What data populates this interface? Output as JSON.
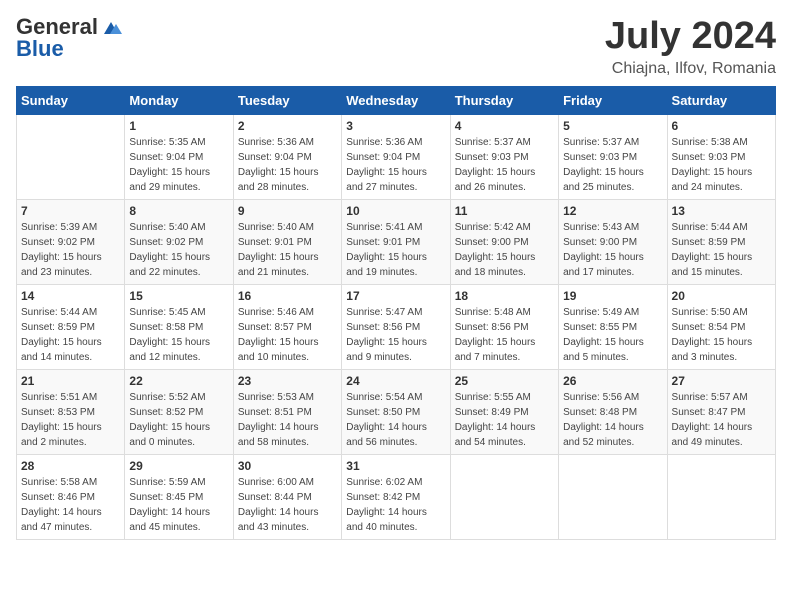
{
  "logo": {
    "general": "General",
    "blue": "Blue"
  },
  "title": "July 2024",
  "location": "Chiajna, Ilfov, Romania",
  "days_of_week": [
    "Sunday",
    "Monday",
    "Tuesday",
    "Wednesday",
    "Thursday",
    "Friday",
    "Saturday"
  ],
  "weeks": [
    [
      {
        "day": "",
        "sunrise": "",
        "sunset": "",
        "daylight": ""
      },
      {
        "day": "1",
        "sunrise": "Sunrise: 5:35 AM",
        "sunset": "Sunset: 9:04 PM",
        "daylight": "Daylight: 15 hours and 29 minutes."
      },
      {
        "day": "2",
        "sunrise": "Sunrise: 5:36 AM",
        "sunset": "Sunset: 9:04 PM",
        "daylight": "Daylight: 15 hours and 28 minutes."
      },
      {
        "day": "3",
        "sunrise": "Sunrise: 5:36 AM",
        "sunset": "Sunset: 9:04 PM",
        "daylight": "Daylight: 15 hours and 27 minutes."
      },
      {
        "day": "4",
        "sunrise": "Sunrise: 5:37 AM",
        "sunset": "Sunset: 9:03 PM",
        "daylight": "Daylight: 15 hours and 26 minutes."
      },
      {
        "day": "5",
        "sunrise": "Sunrise: 5:37 AM",
        "sunset": "Sunset: 9:03 PM",
        "daylight": "Daylight: 15 hours and 25 minutes."
      },
      {
        "day": "6",
        "sunrise": "Sunrise: 5:38 AM",
        "sunset": "Sunset: 9:03 PM",
        "daylight": "Daylight: 15 hours and 24 minutes."
      }
    ],
    [
      {
        "day": "7",
        "sunrise": "Sunrise: 5:39 AM",
        "sunset": "Sunset: 9:02 PM",
        "daylight": "Daylight: 15 hours and 23 minutes."
      },
      {
        "day": "8",
        "sunrise": "Sunrise: 5:40 AM",
        "sunset": "Sunset: 9:02 PM",
        "daylight": "Daylight: 15 hours and 22 minutes."
      },
      {
        "day": "9",
        "sunrise": "Sunrise: 5:40 AM",
        "sunset": "Sunset: 9:01 PM",
        "daylight": "Daylight: 15 hours and 21 minutes."
      },
      {
        "day": "10",
        "sunrise": "Sunrise: 5:41 AM",
        "sunset": "Sunset: 9:01 PM",
        "daylight": "Daylight: 15 hours and 19 minutes."
      },
      {
        "day": "11",
        "sunrise": "Sunrise: 5:42 AM",
        "sunset": "Sunset: 9:00 PM",
        "daylight": "Daylight: 15 hours and 18 minutes."
      },
      {
        "day": "12",
        "sunrise": "Sunrise: 5:43 AM",
        "sunset": "Sunset: 9:00 PM",
        "daylight": "Daylight: 15 hours and 17 minutes."
      },
      {
        "day": "13",
        "sunrise": "Sunrise: 5:44 AM",
        "sunset": "Sunset: 8:59 PM",
        "daylight": "Daylight: 15 hours and 15 minutes."
      }
    ],
    [
      {
        "day": "14",
        "sunrise": "Sunrise: 5:44 AM",
        "sunset": "Sunset: 8:59 PM",
        "daylight": "Daylight: 15 hours and 14 minutes."
      },
      {
        "day": "15",
        "sunrise": "Sunrise: 5:45 AM",
        "sunset": "Sunset: 8:58 PM",
        "daylight": "Daylight: 15 hours and 12 minutes."
      },
      {
        "day": "16",
        "sunrise": "Sunrise: 5:46 AM",
        "sunset": "Sunset: 8:57 PM",
        "daylight": "Daylight: 15 hours and 10 minutes."
      },
      {
        "day": "17",
        "sunrise": "Sunrise: 5:47 AM",
        "sunset": "Sunset: 8:56 PM",
        "daylight": "Daylight: 15 hours and 9 minutes."
      },
      {
        "day": "18",
        "sunrise": "Sunrise: 5:48 AM",
        "sunset": "Sunset: 8:56 PM",
        "daylight": "Daylight: 15 hours and 7 minutes."
      },
      {
        "day": "19",
        "sunrise": "Sunrise: 5:49 AM",
        "sunset": "Sunset: 8:55 PM",
        "daylight": "Daylight: 15 hours and 5 minutes."
      },
      {
        "day": "20",
        "sunrise": "Sunrise: 5:50 AM",
        "sunset": "Sunset: 8:54 PM",
        "daylight": "Daylight: 15 hours and 3 minutes."
      }
    ],
    [
      {
        "day": "21",
        "sunrise": "Sunrise: 5:51 AM",
        "sunset": "Sunset: 8:53 PM",
        "daylight": "Daylight: 15 hours and 2 minutes."
      },
      {
        "day": "22",
        "sunrise": "Sunrise: 5:52 AM",
        "sunset": "Sunset: 8:52 PM",
        "daylight": "Daylight: 15 hours and 0 minutes."
      },
      {
        "day": "23",
        "sunrise": "Sunrise: 5:53 AM",
        "sunset": "Sunset: 8:51 PM",
        "daylight": "Daylight: 14 hours and 58 minutes."
      },
      {
        "day": "24",
        "sunrise": "Sunrise: 5:54 AM",
        "sunset": "Sunset: 8:50 PM",
        "daylight": "Daylight: 14 hours and 56 minutes."
      },
      {
        "day": "25",
        "sunrise": "Sunrise: 5:55 AM",
        "sunset": "Sunset: 8:49 PM",
        "daylight": "Daylight: 14 hours and 54 minutes."
      },
      {
        "day": "26",
        "sunrise": "Sunrise: 5:56 AM",
        "sunset": "Sunset: 8:48 PM",
        "daylight": "Daylight: 14 hours and 52 minutes."
      },
      {
        "day": "27",
        "sunrise": "Sunrise: 5:57 AM",
        "sunset": "Sunset: 8:47 PM",
        "daylight": "Daylight: 14 hours and 49 minutes."
      }
    ],
    [
      {
        "day": "28",
        "sunrise": "Sunrise: 5:58 AM",
        "sunset": "Sunset: 8:46 PM",
        "daylight": "Daylight: 14 hours and 47 minutes."
      },
      {
        "day": "29",
        "sunrise": "Sunrise: 5:59 AM",
        "sunset": "Sunset: 8:45 PM",
        "daylight": "Daylight: 14 hours and 45 minutes."
      },
      {
        "day": "30",
        "sunrise": "Sunrise: 6:00 AM",
        "sunset": "Sunset: 8:44 PM",
        "daylight": "Daylight: 14 hours and 43 minutes."
      },
      {
        "day": "31",
        "sunrise": "Sunrise: 6:02 AM",
        "sunset": "Sunset: 8:42 PM",
        "daylight": "Daylight: 14 hours and 40 minutes."
      },
      {
        "day": "",
        "sunrise": "",
        "sunset": "",
        "daylight": ""
      },
      {
        "day": "",
        "sunrise": "",
        "sunset": "",
        "daylight": ""
      },
      {
        "day": "",
        "sunrise": "",
        "sunset": "",
        "daylight": ""
      }
    ]
  ]
}
